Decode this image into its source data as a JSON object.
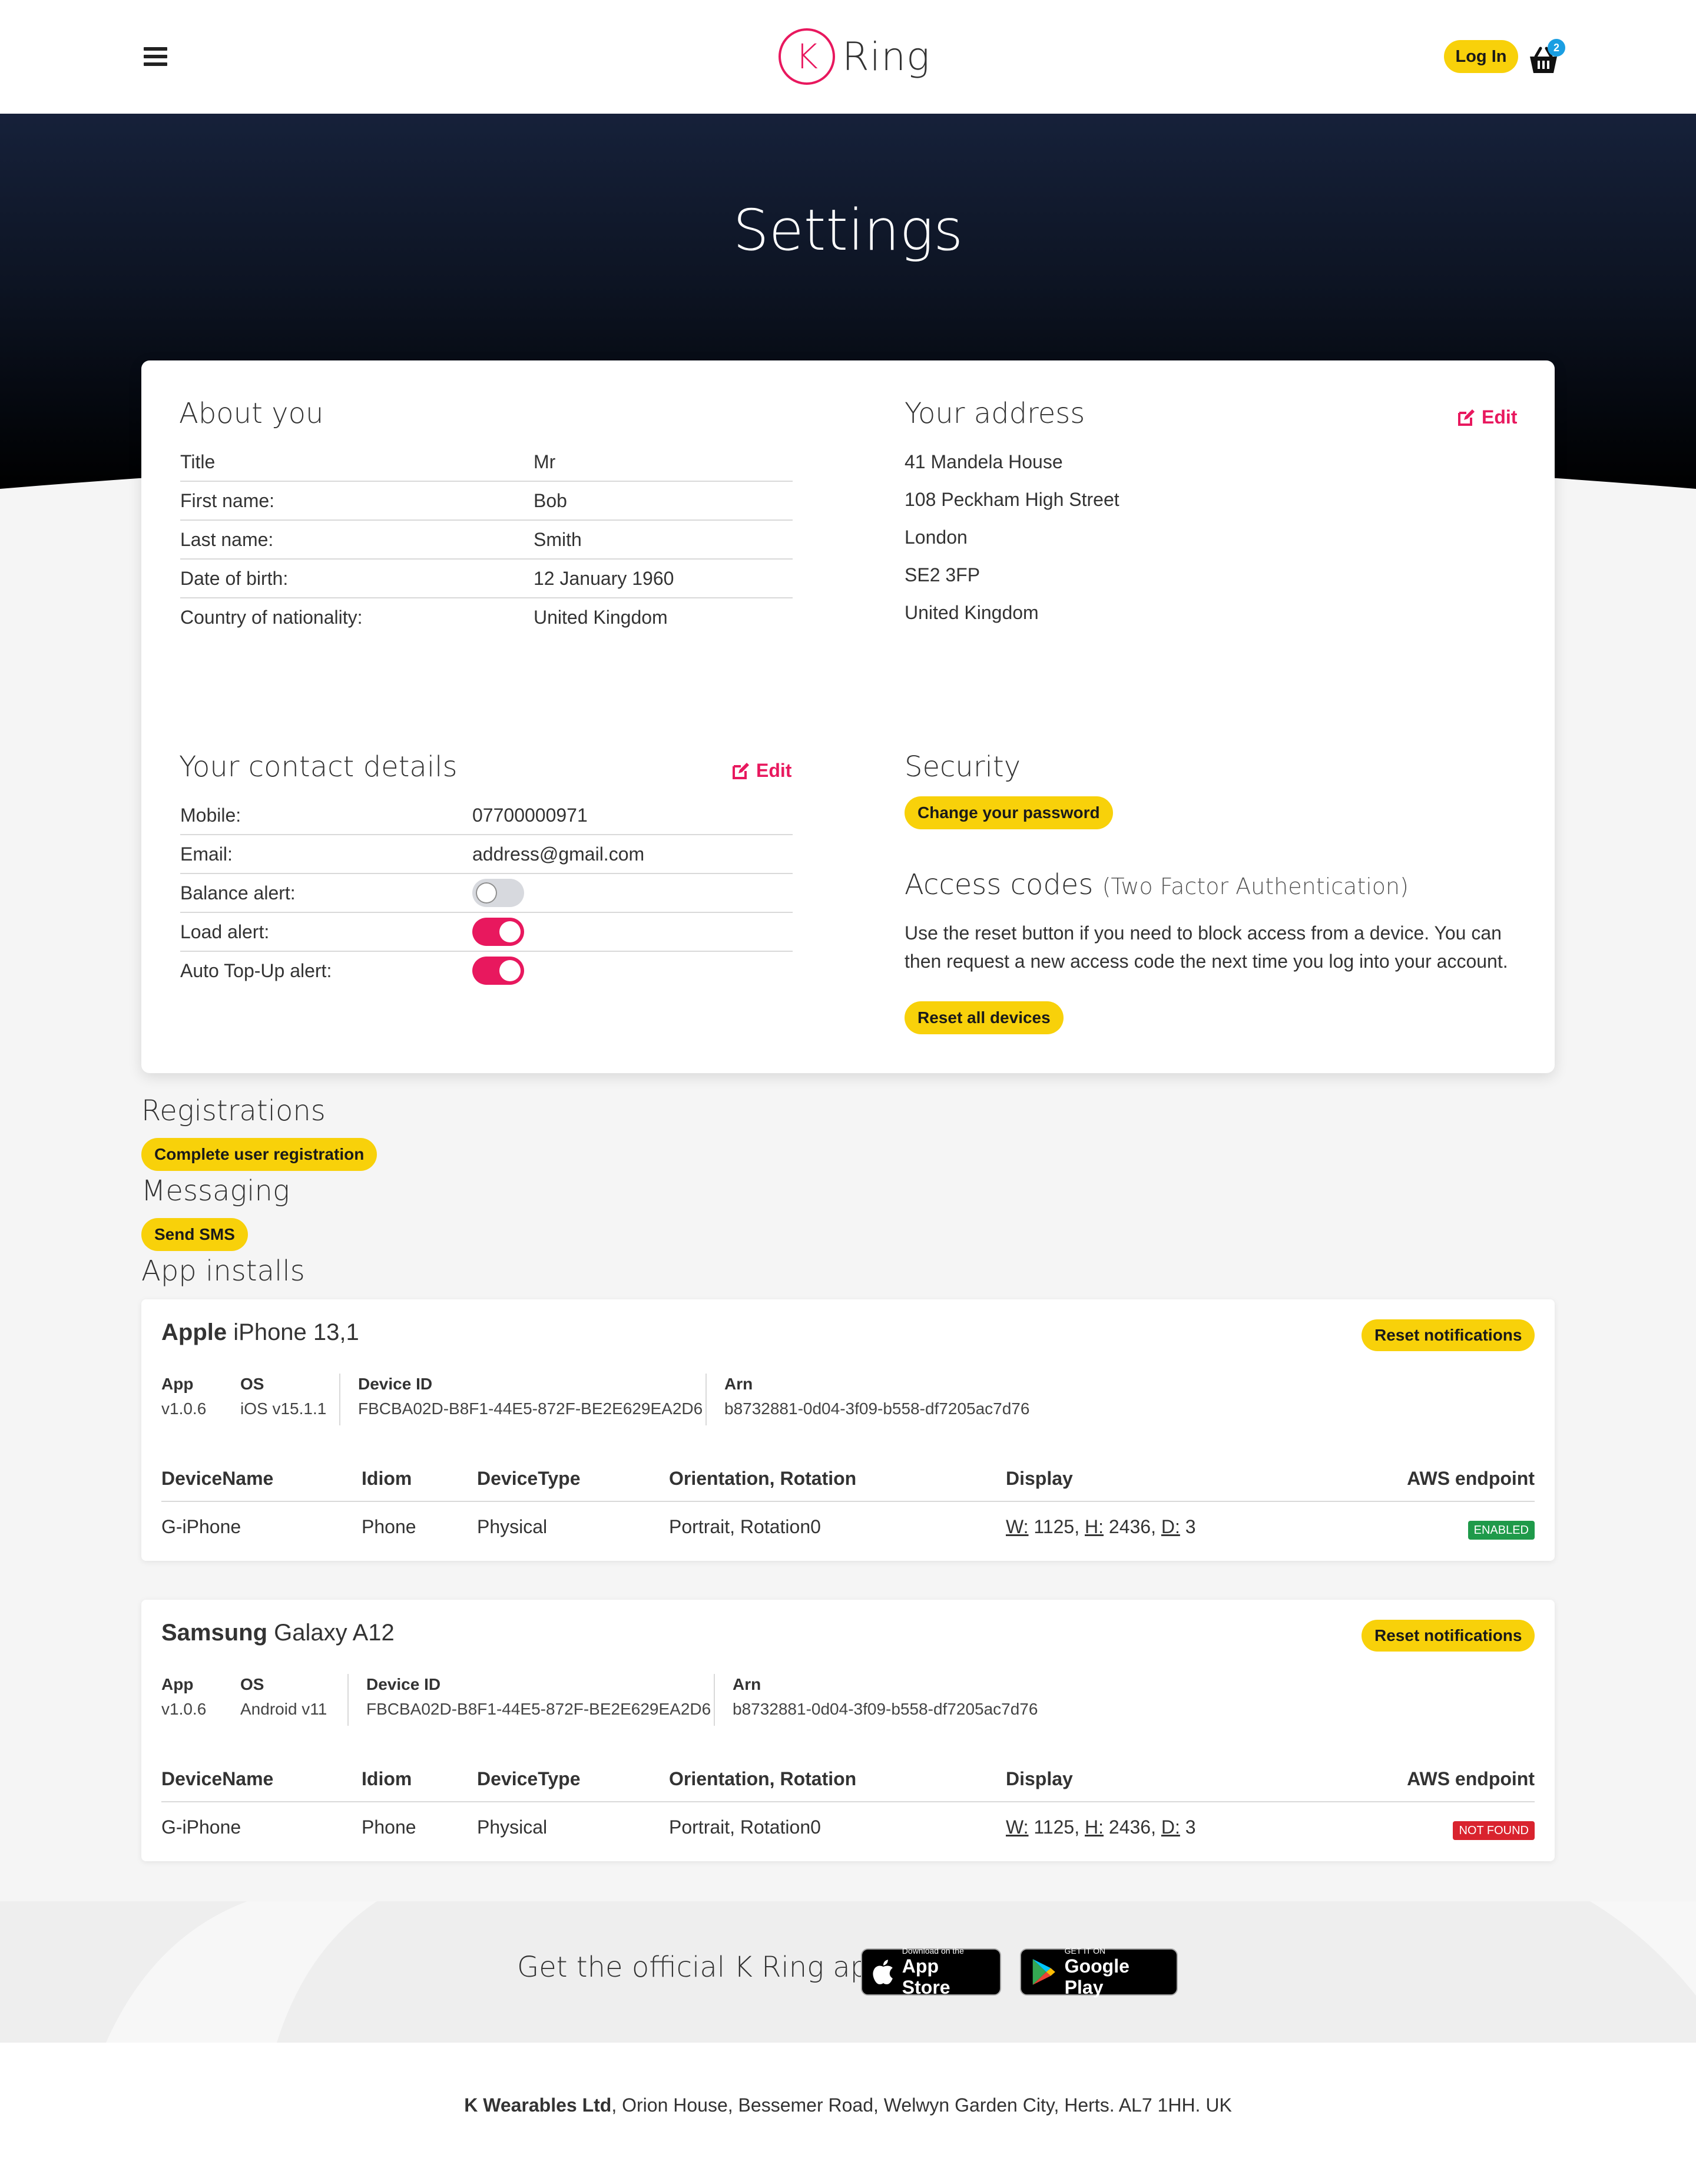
{
  "header": {
    "logo_letter": "K",
    "logo_name": "Ring",
    "login_label": "Log In",
    "basket_count": "2"
  },
  "hero": {
    "title": "Settings"
  },
  "about": {
    "title": "About you",
    "rows": [
      {
        "label": "Title",
        "value": "Mr"
      },
      {
        "label": "First name:",
        "value": "Bob"
      },
      {
        "label": "Last name:",
        "value": "Smith"
      },
      {
        "label": "Date of birth:",
        "value": "12 January 1960"
      },
      {
        "label": "Country of nationality:",
        "value": "United Kingdom"
      }
    ]
  },
  "address": {
    "title": "Your address",
    "edit_label": "Edit",
    "lines": [
      "41 Mandela House",
      "108 Peckham High Street",
      "London",
      "SE2 3FP",
      "United Kingdom"
    ]
  },
  "contact": {
    "title": "Your contact details",
    "edit_label": "Edit",
    "rows": [
      {
        "label": "Mobile:",
        "value": "07700000971"
      },
      {
        "label": "Email:",
        "value": "address@gmail.com"
      },
      {
        "label": "Balance alert:",
        "toggle": "off"
      },
      {
        "label": "Load alert:",
        "toggle": "on"
      },
      {
        "label": "Auto Top-Up alert:",
        "toggle": "on"
      }
    ]
  },
  "security": {
    "title": "Security",
    "change_password_label": "Change your password"
  },
  "access_codes": {
    "title": "Access codes",
    "subtitle": "(Two Factor Authentication)",
    "description": "Use the reset button if you need to block access from a device. You can then request a new access code the next time you log into your account.",
    "reset_label": "Reset all devices"
  },
  "registrations": {
    "title": "Registrations",
    "button_label": "Complete user registration"
  },
  "messaging": {
    "title": "Messaging",
    "button_label": "Send SMS"
  },
  "app_installs": {
    "title": "App installs",
    "columns": [
      "DeviceName",
      "Idiom",
      "DeviceType",
      "Orientation, Rotation",
      "Display",
      "AWS endpoint"
    ],
    "devices": [
      {
        "brand": "Apple",
        "model": "iPhone 13,1",
        "reset_label": "Reset notifications",
        "meta": {
          "app_label": "App",
          "app_value": "v1.0.6",
          "os_label": "OS",
          "os_value": "iOS v15.1.1",
          "device_id_label": "Device ID",
          "device_id_value": "FBCBA02D-B8F1-44E5-872F-BE2E629EA2D6",
          "arn_label": "Arn",
          "arn_value": "b8732881-0d04-3f09-b558-df7205ac7d76"
        },
        "row": {
          "device_name": "G-iPhone",
          "idiom": "Phone",
          "device_type": "Physical",
          "orientation": "Portrait, Rotation0",
          "w_label": "W:",
          "w_value": "1125,",
          "h_label": "H:",
          "h_value": "2436,",
          "d_label": "D:",
          "d_value": "3",
          "aws_status": "ENABLED"
        }
      },
      {
        "brand": "Samsung",
        "model": "Galaxy A12",
        "reset_label": "Reset notifications",
        "meta": {
          "app_label": "App",
          "app_value": "v1.0.6",
          "os_label": "OS",
          "os_value": "Android v11",
          "device_id_label": "Device ID",
          "device_id_value": "FBCBA02D-B8F1-44E5-872F-BE2E629EA2D6",
          "arn_label": "Arn",
          "arn_value": "b8732881-0d04-3f09-b558-df7205ac7d76"
        },
        "row": {
          "device_name": "G-iPhone",
          "idiom": "Phone",
          "device_type": "Physical",
          "orientation": "Portrait, Rotation0",
          "w_label": "W:",
          "w_value": "1125,",
          "h_label": "H:",
          "h_value": "2436,",
          "d_label": "D:",
          "d_value": "3",
          "aws_status": "NOT FOUND"
        }
      }
    ]
  },
  "app_banner": {
    "text": "Get the official K Ring app",
    "app_store_small": "Download on the",
    "app_store_big": "App Store",
    "google_small": "GET IT ON",
    "google_big": "Google Play"
  },
  "footer": {
    "company": "K Wearables Ltd",
    "address": ", Orion House, Bessemer Road, Welwyn Garden City, Herts. AL7 1HH. UK"
  },
  "colors": {
    "accent_pink": "#e8185e",
    "button_yellow": "#f8d10a",
    "badge_blue": "#1a9ee2",
    "status_enabled": "#1f9a4a",
    "status_not_found": "#d9232e"
  }
}
